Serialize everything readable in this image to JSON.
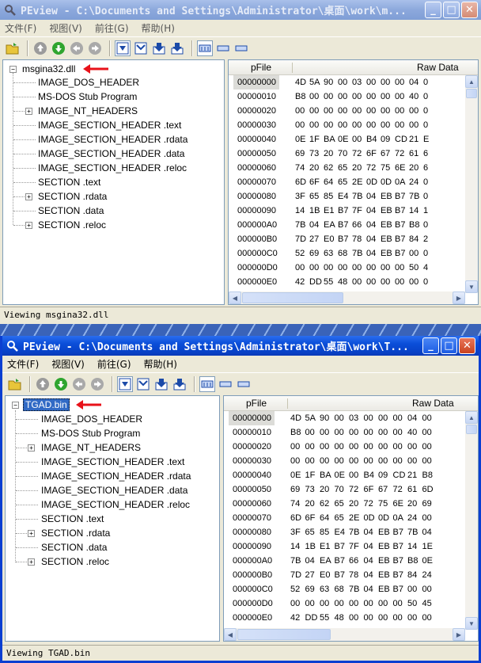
{
  "windows": [
    {
      "title": "PEview - C:\\Documents and Settings\\Administrator\\桌面\\work\\m...",
      "menu": [
        "文件(F)",
        "视图(V)",
        "前往(G)",
        "帮助(H)"
      ],
      "tree": {
        "root": "msgina32.dll",
        "children": [
          {
            "label": "IMAGE_DOS_HEADER",
            "expandable": false
          },
          {
            "label": "MS-DOS Stub Program",
            "expandable": false
          },
          {
            "label": "IMAGE_NT_HEADERS",
            "expandable": true
          },
          {
            "label": "IMAGE_SECTION_HEADER .text",
            "expandable": false
          },
          {
            "label": "IMAGE_SECTION_HEADER .rdata",
            "expandable": false
          },
          {
            "label": "IMAGE_SECTION_HEADER .data",
            "expandable": false
          },
          {
            "label": "IMAGE_SECTION_HEADER .reloc",
            "expandable": false
          },
          {
            "label": "SECTION .text",
            "expandable": false
          },
          {
            "label": "SECTION .rdata",
            "expandable": true
          },
          {
            "label": "SECTION .data",
            "expandable": false
          },
          {
            "label": "SECTION .reloc",
            "expandable": true
          }
        ]
      },
      "columns": [
        "pFile",
        "Raw Data"
      ],
      "rows": [
        {
          "offset": "00000000",
          "bytes": [
            "4D",
            "5A",
            "90",
            "00",
            "03",
            "00",
            "00",
            "00",
            "04",
            "0"
          ]
        },
        {
          "offset": "00000010",
          "bytes": [
            "B8",
            "00",
            "00",
            "00",
            "00",
            "00",
            "00",
            "00",
            "40",
            "0"
          ]
        },
        {
          "offset": "00000020",
          "bytes": [
            "00",
            "00",
            "00",
            "00",
            "00",
            "00",
            "00",
            "00",
            "00",
            "0"
          ]
        },
        {
          "offset": "00000030",
          "bytes": [
            "00",
            "00",
            "00",
            "00",
            "00",
            "00",
            "00",
            "00",
            "00",
            "0"
          ]
        },
        {
          "offset": "00000040",
          "bytes": [
            "0E",
            "1F",
            "BA",
            "0E",
            "00",
            "B4",
            "09",
            "CD",
            "21",
            "E"
          ]
        },
        {
          "offset": "00000050",
          "bytes": [
            "69",
            "73",
            "20",
            "70",
            "72",
            "6F",
            "67",
            "72",
            "61",
            "6"
          ]
        },
        {
          "offset": "00000060",
          "bytes": [
            "74",
            "20",
            "62",
            "65",
            "20",
            "72",
            "75",
            "6E",
            "20",
            "6"
          ]
        },
        {
          "offset": "00000070",
          "bytes": [
            "6D",
            "6F",
            "64",
            "65",
            "2E",
            "0D",
            "0D",
            "0A",
            "24",
            "0"
          ]
        },
        {
          "offset": "00000080",
          "bytes": [
            "3F",
            "65",
            "85",
            "E4",
            "7B",
            "04",
            "EB",
            "B7",
            "7B",
            "0"
          ]
        },
        {
          "offset": "00000090",
          "bytes": [
            "14",
            "1B",
            "E1",
            "B7",
            "7F",
            "04",
            "EB",
            "B7",
            "14",
            "1"
          ]
        },
        {
          "offset": "000000A0",
          "bytes": [
            "7B",
            "04",
            "EA",
            "B7",
            "66",
            "04",
            "EB",
            "B7",
            "B8",
            "0"
          ]
        },
        {
          "offset": "000000B0",
          "bytes": [
            "7D",
            "27",
            "E0",
            "B7",
            "78",
            "04",
            "EB",
            "B7",
            "84",
            "2"
          ]
        },
        {
          "offset": "000000C0",
          "bytes": [
            "52",
            "69",
            "63",
            "68",
            "7B",
            "04",
            "EB",
            "B7",
            "00",
            "0"
          ]
        },
        {
          "offset": "000000D0",
          "bytes": [
            "00",
            "00",
            "00",
            "00",
            "00",
            "00",
            "00",
            "00",
            "50",
            "4"
          ]
        },
        {
          "offset": "000000E0",
          "bytes": [
            "42",
            "DD",
            "55",
            "48",
            "00",
            "00",
            "00",
            "00",
            "00",
            "0"
          ]
        }
      ],
      "status": "Viewing msgina32.dll"
    },
    {
      "title": "PEview - C:\\Documents and Settings\\Administrator\\桌面\\work\\T...",
      "menu": [
        "文件(F)",
        "视图(V)",
        "前往(G)",
        "帮助(H)"
      ],
      "tree": {
        "root": "TGAD.bin",
        "children": [
          {
            "label": "IMAGE_DOS_HEADER",
            "expandable": false
          },
          {
            "label": "MS-DOS Stub Program",
            "expandable": false
          },
          {
            "label": "IMAGE_NT_HEADERS",
            "expandable": true
          },
          {
            "label": "IMAGE_SECTION_HEADER .text",
            "expandable": false
          },
          {
            "label": "IMAGE_SECTION_HEADER .rdata",
            "expandable": false
          },
          {
            "label": "IMAGE_SECTION_HEADER .data",
            "expandable": false
          },
          {
            "label": "IMAGE_SECTION_HEADER .reloc",
            "expandable": false
          },
          {
            "label": "SECTION .text",
            "expandable": false
          },
          {
            "label": "SECTION .rdata",
            "expandable": true
          },
          {
            "label": "SECTION .data",
            "expandable": false
          },
          {
            "label": "SECTION .reloc",
            "expandable": true
          }
        ]
      },
      "columns": [
        "pFile",
        "Raw Data"
      ],
      "rows": [
        {
          "offset": "00000000",
          "bytes": [
            "4D",
            "5A",
            "90",
            "00",
            "03",
            "00",
            "00",
            "00",
            "04",
            "00"
          ]
        },
        {
          "offset": "00000010",
          "bytes": [
            "B8",
            "00",
            "00",
            "00",
            "00",
            "00",
            "00",
            "00",
            "40",
            "00"
          ]
        },
        {
          "offset": "00000020",
          "bytes": [
            "00",
            "00",
            "00",
            "00",
            "00",
            "00",
            "00",
            "00",
            "00",
            "00"
          ]
        },
        {
          "offset": "00000030",
          "bytes": [
            "00",
            "00",
            "00",
            "00",
            "00",
            "00",
            "00",
            "00",
            "00",
            "00"
          ]
        },
        {
          "offset": "00000040",
          "bytes": [
            "0E",
            "1F",
            "BA",
            "0E",
            "00",
            "B4",
            "09",
            "CD",
            "21",
            "B8"
          ]
        },
        {
          "offset": "00000050",
          "bytes": [
            "69",
            "73",
            "20",
            "70",
            "72",
            "6F",
            "67",
            "72",
            "61",
            "6D"
          ]
        },
        {
          "offset": "00000060",
          "bytes": [
            "74",
            "20",
            "62",
            "65",
            "20",
            "72",
            "75",
            "6E",
            "20",
            "69"
          ]
        },
        {
          "offset": "00000070",
          "bytes": [
            "6D",
            "6F",
            "64",
            "65",
            "2E",
            "0D",
            "0D",
            "0A",
            "24",
            "00"
          ]
        },
        {
          "offset": "00000080",
          "bytes": [
            "3F",
            "65",
            "85",
            "E4",
            "7B",
            "04",
            "EB",
            "B7",
            "7B",
            "04"
          ]
        },
        {
          "offset": "00000090",
          "bytes": [
            "14",
            "1B",
            "E1",
            "B7",
            "7F",
            "04",
            "EB",
            "B7",
            "14",
            "1E"
          ]
        },
        {
          "offset": "000000A0",
          "bytes": [
            "7B",
            "04",
            "EA",
            "B7",
            "66",
            "04",
            "EB",
            "B7",
            "B8",
            "0E"
          ]
        },
        {
          "offset": "000000B0",
          "bytes": [
            "7D",
            "27",
            "E0",
            "B7",
            "78",
            "04",
            "EB",
            "B7",
            "84",
            "24"
          ]
        },
        {
          "offset": "000000C0",
          "bytes": [
            "52",
            "69",
            "63",
            "68",
            "7B",
            "04",
            "EB",
            "B7",
            "00",
            "00"
          ]
        },
        {
          "offset": "000000D0",
          "bytes": [
            "00",
            "00",
            "00",
            "00",
            "00",
            "00",
            "00",
            "00",
            "50",
            "45"
          ]
        },
        {
          "offset": "000000E0",
          "bytes": [
            "42",
            "DD",
            "55",
            "48",
            "00",
            "00",
            "00",
            "00",
            "00",
            "00"
          ]
        }
      ],
      "status": "Viewing TGAD.bin"
    }
  ],
  "colors": {
    "selection": "#316ac5",
    "annotation_arrow": "#e8121a",
    "active_title": "#0a4ed8",
    "inactive_title": "#8ca8dc"
  },
  "icons": [
    "open-file-icon",
    "nav-up-icon",
    "nav-down-icon",
    "nav-back-icon",
    "nav-forward-icon",
    "view-a-icon",
    "view-b-icon",
    "view-c-icon",
    "view-d-icon",
    "layout-hex-icon",
    "layout-b-icon",
    "layout-c-icon"
  ]
}
